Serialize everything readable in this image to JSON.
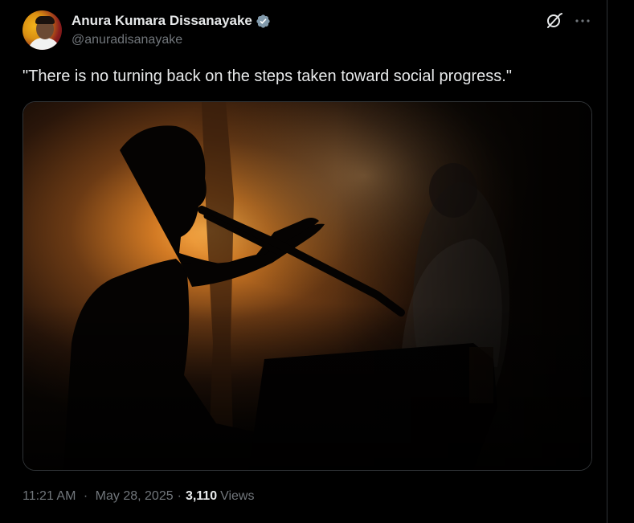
{
  "author": {
    "display_name": "Anura Kumara Dissanayake",
    "handle": "@anuradisanayake",
    "verified_icon": "verified-badge-icon",
    "verified_color": "#1d9bf0"
  },
  "header_actions": {
    "grok_icon": "grok-icon",
    "more_icon": "more-dots-icon"
  },
  "tweet": {
    "text": "\"There is no turning back on the steps taken toward social progress.\""
  },
  "media": {
    "description_icon": "photo-silhouette-speaker-at-podium"
  },
  "meta": {
    "time": "11:21 AM",
    "separator": "·",
    "date": "May 28, 2025",
    "views_count": "3,110",
    "views_label": "Views"
  },
  "colors": {
    "background": "#000000",
    "text_primary": "#e7e9ea",
    "text_secondary": "#71767b",
    "border": "#2f3336"
  }
}
